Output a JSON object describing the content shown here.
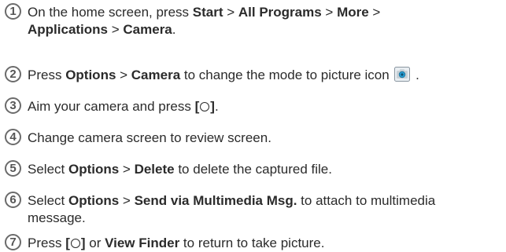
{
  "steps": [
    {
      "number": "1",
      "parts": [
        {
          "t": "On the home screen, press "
        },
        {
          "b": "Start"
        },
        {
          "t": " > "
        },
        {
          "b": "All Programs"
        },
        {
          "t": " > "
        },
        {
          "b": "More"
        },
        {
          "t": " > "
        },
        {
          "br": true
        },
        {
          "b": "Applications"
        },
        {
          "t": " > "
        },
        {
          "b": "Camera"
        },
        {
          "t": "."
        }
      ]
    },
    {
      "number": "2",
      "parts": [
        {
          "t": "Press "
        },
        {
          "b": "Options"
        },
        {
          "t": " > "
        },
        {
          "b": "Camera"
        },
        {
          "t": " to change the mode to picture icon "
        },
        {
          "icon": "camera-icon"
        },
        {
          "t": " ."
        }
      ]
    },
    {
      "number": "3",
      "parts": [
        {
          "t": "Aim your camera and press "
        },
        {
          "b": "["
        },
        {
          "icon": "center-button-icon"
        },
        {
          "b": "]"
        },
        {
          "t": "."
        }
      ]
    },
    {
      "number": "4",
      "parts": [
        {
          "t": "Change camera screen to review screen."
        }
      ]
    },
    {
      "number": "5",
      "parts": [
        {
          "t": "Select "
        },
        {
          "b": "Options"
        },
        {
          "t": " > "
        },
        {
          "b": "Delete"
        },
        {
          "t": " to delete the captured file."
        }
      ]
    },
    {
      "number": "6",
      "parts": [
        {
          "t": "Select "
        },
        {
          "b": "Options"
        },
        {
          "t": " > "
        },
        {
          "b": "Send via Multimedia Msg."
        },
        {
          "t": " to attach to multimedia"
        },
        {
          "br": true
        },
        {
          "t": "message."
        }
      ]
    },
    {
      "number": "7",
      "parts": [
        {
          "t": "Press "
        },
        {
          "b": "["
        },
        {
          "icon": "center-button-icon"
        },
        {
          "b": "]"
        },
        {
          "t": " or "
        },
        {
          "b": "View Finder"
        },
        {
          "t": " to return to take picture."
        }
      ]
    }
  ]
}
